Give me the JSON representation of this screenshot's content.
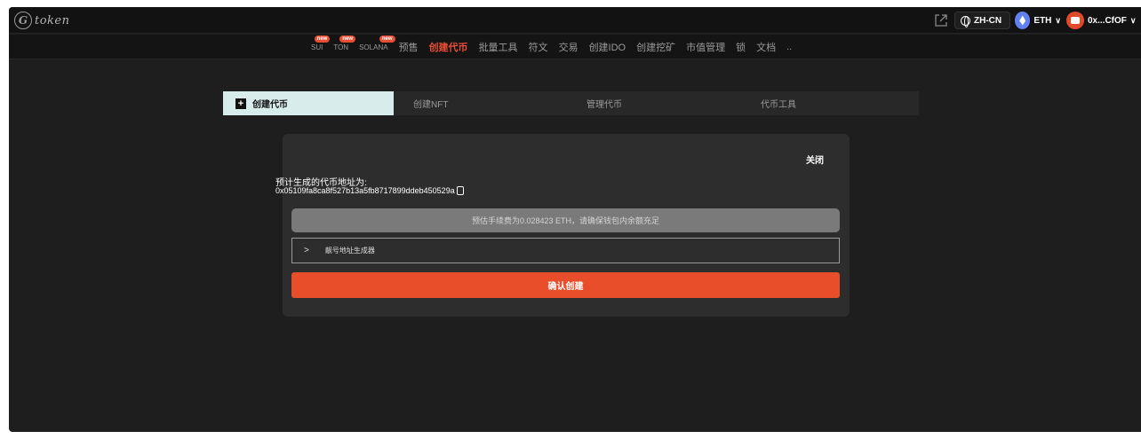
{
  "app": {
    "logo_letter": "G",
    "logo_text": "token"
  },
  "header": {
    "language": "ZH-CN",
    "chain": "ETH",
    "wallet": "0x...CfOF"
  },
  "nav": {
    "items": [
      {
        "label": "SUI",
        "badge": "new",
        "size": "sm"
      },
      {
        "label": "TON",
        "badge": "new",
        "size": "sm"
      },
      {
        "label": "SOLANA",
        "badge": "new",
        "size": "sm"
      },
      {
        "label": "预售"
      },
      {
        "label": "创建代币",
        "active": true
      },
      {
        "label": "批量工具"
      },
      {
        "label": "符文"
      },
      {
        "label": "交易"
      },
      {
        "label": "创建IDO"
      },
      {
        "label": "创建挖矿"
      },
      {
        "label": "市值管理"
      },
      {
        "label": "锁"
      },
      {
        "label": "文档"
      },
      {
        "label": ".."
      }
    ]
  },
  "tabs": {
    "create_token": "创建代币",
    "create_nft": "创建NFT",
    "manage_token": "管理代币",
    "token_tools": "代币工具"
  },
  "dialog": {
    "close_label": "关闭",
    "address_label": "预计生成的代币地址为:",
    "address_value": "0x05109fa8ca8f527b13a5fb8717899ddeb450529a",
    "fee_notice": "预估手续费为0.028423 ETH，请确保钱包内余额充足",
    "vanity_toggle": ">",
    "vanity_label": "靓号地址生成器",
    "confirm_label": "确认创建"
  },
  "colors": {
    "accent": "#e84e2a",
    "background": "#1e1e1e",
    "active_tab": "#d9ecec"
  }
}
